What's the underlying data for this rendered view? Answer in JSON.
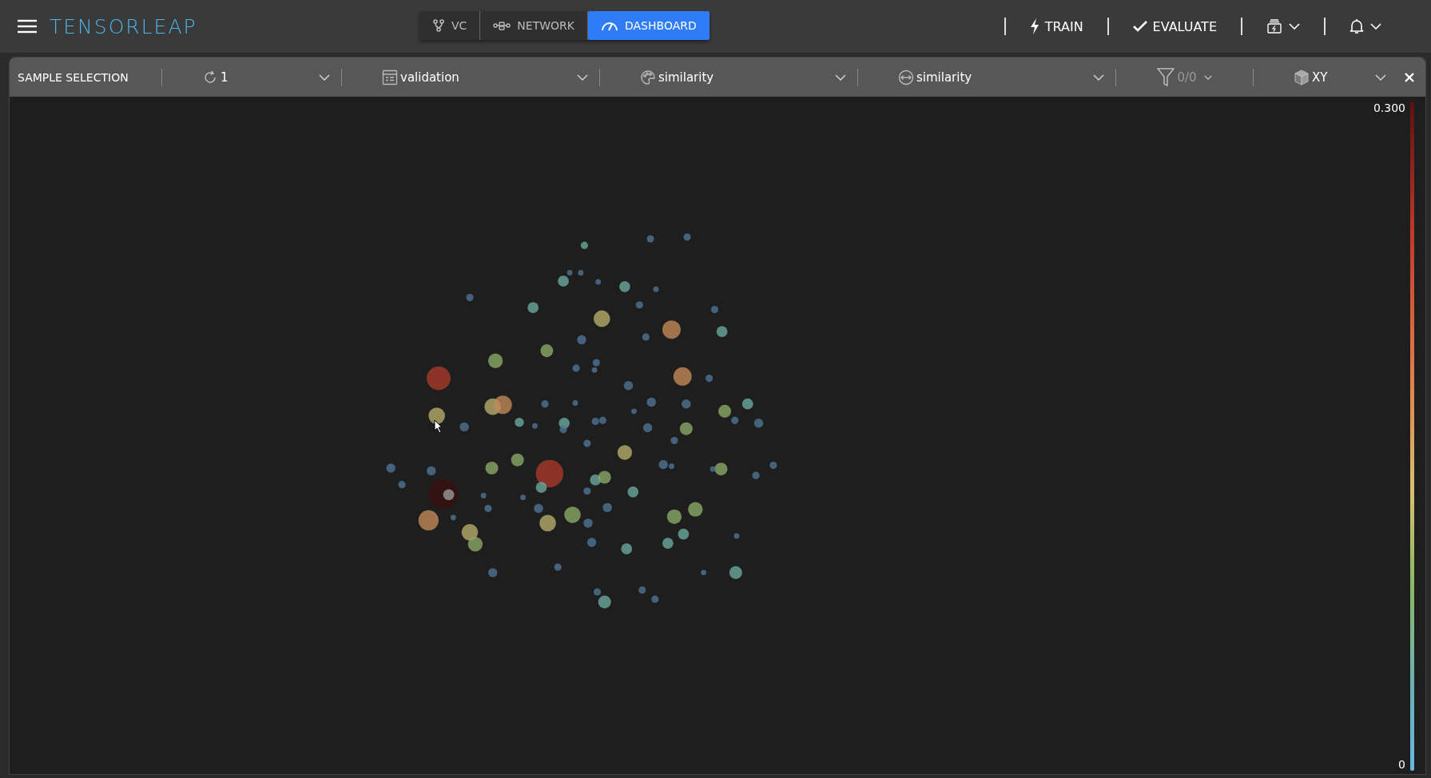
{
  "header": {
    "logo": "TENSORLEAP",
    "views": [
      {
        "kind": "vc",
        "label": "VC",
        "selected": false
      },
      {
        "kind": "network",
        "label": "NETWORK",
        "selected": false
      },
      {
        "kind": "dashboard",
        "label": "DASHBOARD",
        "selected": true
      }
    ],
    "actions": [
      {
        "kind": "train",
        "label": "TRAIN"
      },
      {
        "kind": "evaluate",
        "label": "EVALUATE"
      }
    ]
  },
  "panel": {
    "title": "SAMPLE SELECTION",
    "selectors": [
      {
        "kind": "epoch",
        "value": "1",
        "disabled": false
      },
      {
        "kind": "dataset",
        "value": "validation",
        "disabled": false
      },
      {
        "kind": "color",
        "value": "similarity",
        "disabled": false
      },
      {
        "kind": "size",
        "value": "similarity",
        "disabled": false
      },
      {
        "kind": "filter",
        "value": "0/0",
        "disabled": true
      },
      {
        "kind": "projection",
        "value": "XY",
        "disabled": false
      }
    ],
    "legend": {
      "max": "0.300",
      "min": "0"
    }
  }
}
